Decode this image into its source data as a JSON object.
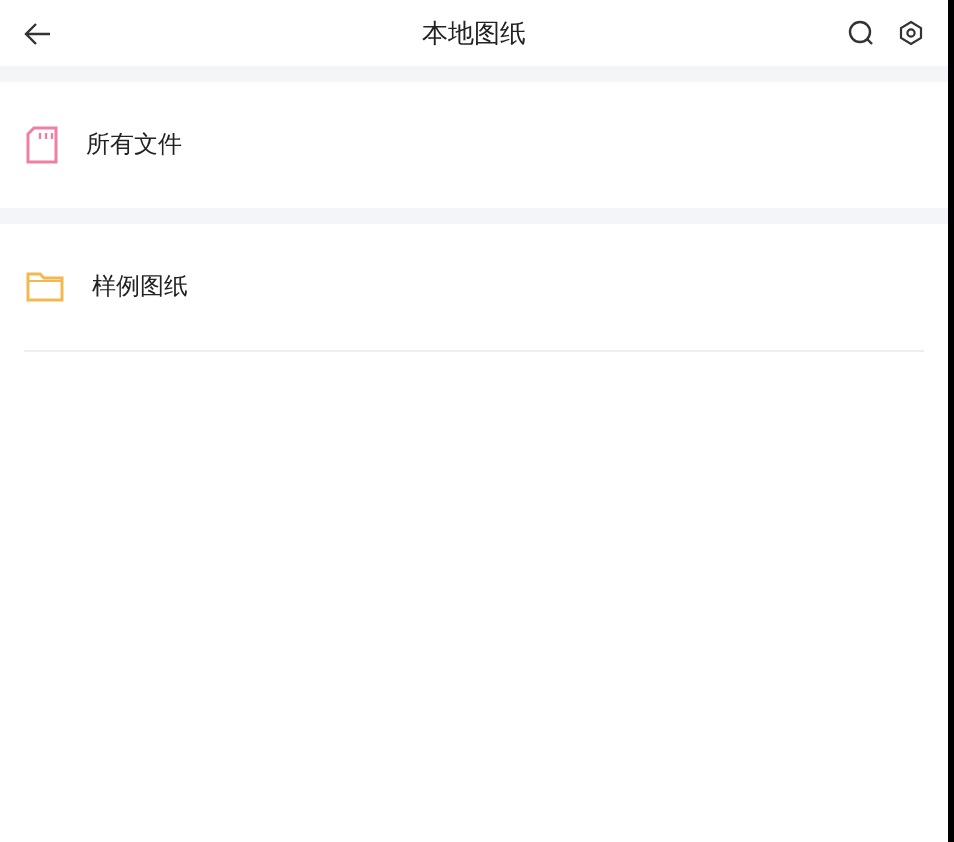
{
  "header": {
    "title": "本地图纸"
  },
  "sections": [
    {
      "items": [
        {
          "kind": "sdcard",
          "label": "所有文件"
        }
      ]
    },
    {
      "items": [
        {
          "kind": "folder",
          "label": "样例图纸"
        }
      ]
    }
  ]
}
